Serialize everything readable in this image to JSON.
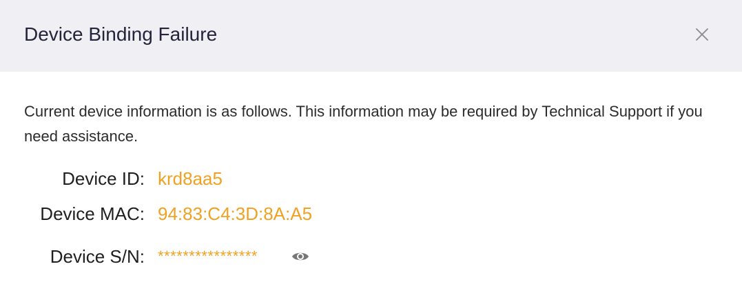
{
  "dialog": {
    "title": "Device Binding Failure",
    "close_icon": "close-icon",
    "description": "Current device information is as follows. This information may be required by Technical Support if you need assistance.",
    "fields": {
      "device_id": {
        "label": "Device ID:",
        "value": "krd8aa5"
      },
      "device_mac": {
        "label": "Device MAC:",
        "value": "94:83:C4:3D:8A:A5"
      },
      "device_sn": {
        "label": "Device S/N:",
        "value": "****************",
        "toggle_icon": "eye-icon"
      }
    },
    "colors": {
      "header_bg": "#efeff4",
      "value_accent": "#f0a122",
      "title_text": "#23233a",
      "icon_gray": "#777777"
    }
  }
}
